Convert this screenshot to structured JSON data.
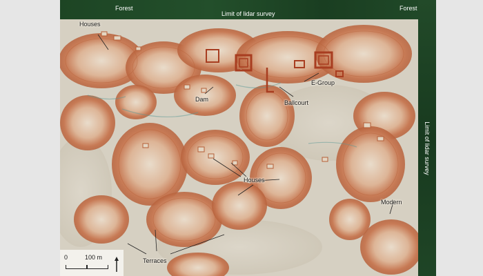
{
  "map": {
    "top_left_label": "Forest",
    "top_right_label": "Forest",
    "top_center_label": "Limit of lidar survey",
    "right_label": "Limit of lidar survey",
    "features": {
      "houses_top": "Houses",
      "dam": "Dam",
      "ballcourt": "Ballcourt",
      "e_group": "E-Group",
      "houses_center": "Houses",
      "modern": "Modern",
      "terraces": "Terraces"
    },
    "scale": {
      "zero": "0",
      "distance": "100 m"
    },
    "icons": {
      "north": "north-arrow-icon"
    },
    "colors": {
      "forest": "#1d4524",
      "ground": "#d8d2c4",
      "relief": "#c9774f",
      "structure": "#b84a2a"
    }
  }
}
